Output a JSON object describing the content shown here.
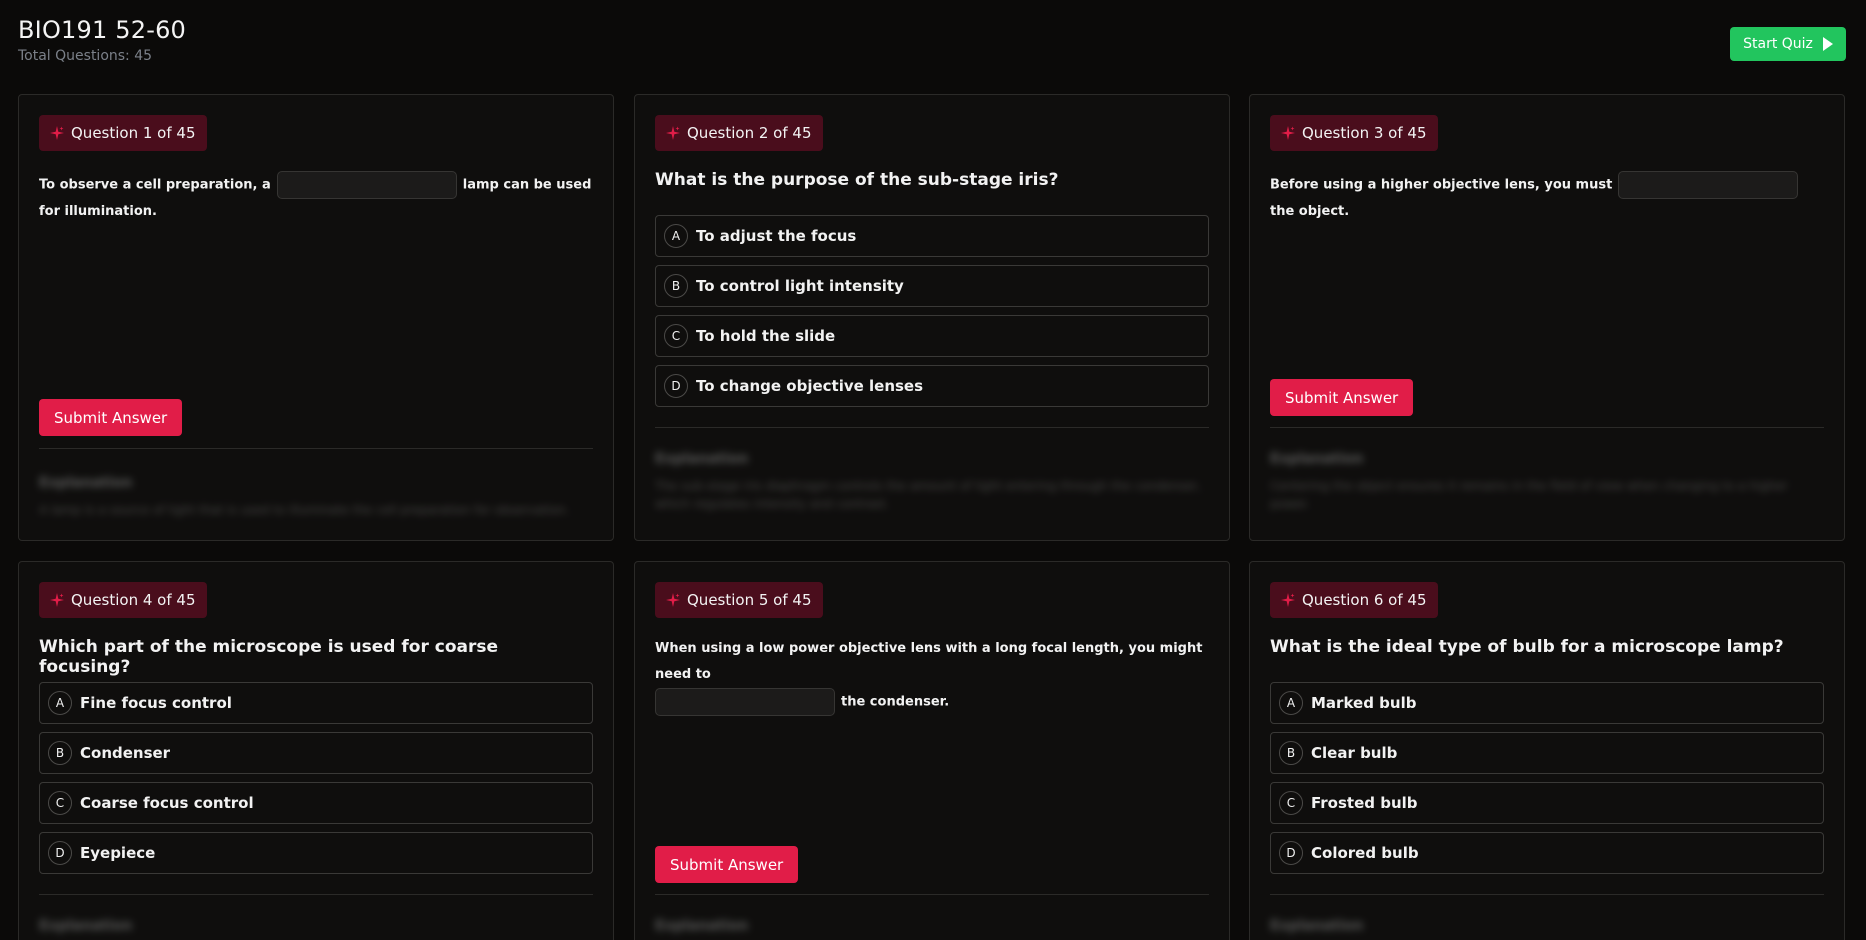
{
  "header": {
    "title": "BIO191 52-60",
    "subtitle": "Total Questions: 45",
    "start_label": "Start Quiz"
  },
  "colors": {
    "accent": "#e11d48",
    "start": "#22c55e",
    "badge_bg": "#4a0d1c",
    "background": "#0b0a09"
  },
  "questions": [
    {
      "badge": "Question 1 of 45",
      "type": "fill",
      "before": "To observe a cell preparation, a",
      "after": "lamp can be used for illumination.",
      "submit": "Submit Answer",
      "explanation_title": "Explanation",
      "explanation_body": "A lamp is a source of light that is used to illuminate the cell preparation for observation."
    },
    {
      "badge": "Question 2 of 45",
      "type": "mc",
      "question": "What is the purpose of the sub-stage iris?",
      "options": [
        {
          "letter": "A",
          "text": "To adjust the focus"
        },
        {
          "letter": "B",
          "text": "To control light intensity"
        },
        {
          "letter": "C",
          "text": "To hold the slide"
        },
        {
          "letter": "D",
          "text": "To change objective lenses"
        }
      ],
      "explanation_title": "Explanation",
      "explanation_body": "The sub-stage iris diaphragm controls the amount of light entering through the condenser, which regulates intensity and contrast."
    },
    {
      "badge": "Question 3 of 45",
      "type": "fill",
      "before": "Before using a higher objective lens, you must",
      "after": "the object.",
      "submit": "Submit Answer",
      "explanation_title": "Explanation",
      "explanation_body": "Centering the object ensures it remains in the field of view when changing to a higher power."
    },
    {
      "badge": "Question 4 of 45",
      "type": "mc",
      "question": "Which part of the microscope is used for coarse focusing?",
      "options": [
        {
          "letter": "A",
          "text": "Fine focus control"
        },
        {
          "letter": "B",
          "text": "Condenser"
        },
        {
          "letter": "C",
          "text": "Coarse focus control"
        },
        {
          "letter": "D",
          "text": "Eyepiece"
        }
      ],
      "explanation_title": "Explanation",
      "explanation_body": ""
    },
    {
      "badge": "Question 5 of 45",
      "type": "fill",
      "before": "When using a low power objective lens with a long focal length, you might need to",
      "after": "the condenser.",
      "submit": "Submit Answer",
      "explanation_title": "Explanation",
      "explanation_body": ""
    },
    {
      "badge": "Question 6 of 45",
      "type": "mc",
      "question": "What is the ideal type of bulb for a microscope lamp?",
      "options": [
        {
          "letter": "A",
          "text": "Marked bulb"
        },
        {
          "letter": "B",
          "text": "Clear bulb"
        },
        {
          "letter": "C",
          "text": "Frosted bulb"
        },
        {
          "letter": "D",
          "text": "Colored bulb"
        }
      ],
      "explanation_title": "Explanation",
      "explanation_body": ""
    }
  ]
}
